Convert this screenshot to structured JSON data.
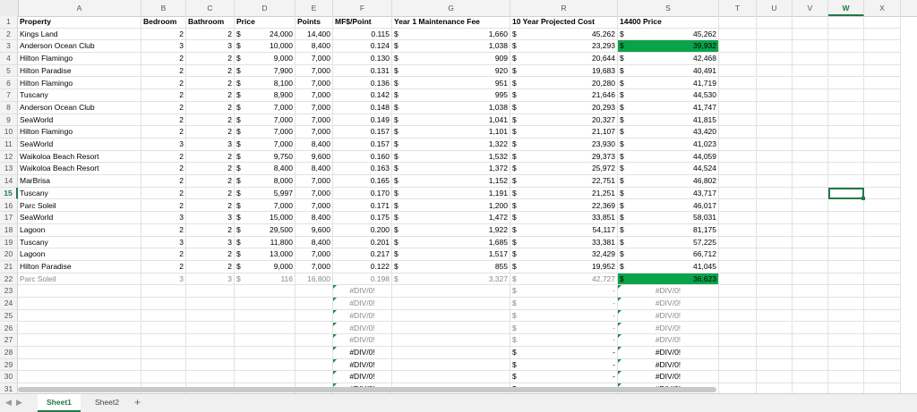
{
  "columns": [
    "A",
    "B",
    "C",
    "D",
    "E",
    "F",
    "G",
    "R",
    "S",
    "T",
    "U",
    "V",
    "W",
    "X"
  ],
  "selected_column": "W",
  "selected_row": "15",
  "header_row": {
    "property": "Property",
    "bedroom": "Bedroom",
    "bathroom": "Bathroom",
    "price": "Price",
    "points": "Points",
    "mf_point": "MF$/Point",
    "maint_fee": "Year 1 Maintenance Fee",
    "projected": "10 Year Projected Cost",
    "price14400": "14400 Price"
  },
  "rows": [
    {
      "n": "2",
      "property": "Kings Land",
      "bed": "2",
      "bath": "2",
      "price": "24,000",
      "points": "14,400",
      "mf": "0.115",
      "fee": "1,660",
      "proj": "45,262",
      "p14": "45,262"
    },
    {
      "n": "3",
      "property": "Anderson Ocean Club",
      "bed": "3",
      "bath": "3",
      "price": "10,000",
      "points": "8,400",
      "mf": "0.124",
      "fee": "1,038",
      "proj": "23,293",
      "p14": "39,932",
      "hl": true
    },
    {
      "n": "4",
      "property": "Hilton Flamingo",
      "bed": "2",
      "bath": "2",
      "price": "9,000",
      "points": "7,000",
      "mf": "0.130",
      "fee": "909",
      "proj": "20,644",
      "p14": "42,468"
    },
    {
      "n": "5",
      "property": "Hilton Paradise",
      "bed": "2",
      "bath": "2",
      "price": "7,900",
      "points": "7,000",
      "mf": "0.131",
      "fee": "920",
      "proj": "19,683",
      "p14": "40,491"
    },
    {
      "n": "6",
      "property": "Hilton Flamingo",
      "bed": "2",
      "bath": "2",
      "price": "8,100",
      "points": "7,000",
      "mf": "0.136",
      "fee": "951",
      "proj": "20,280",
      "p14": "41,719"
    },
    {
      "n": "7",
      "property": "Tuscany",
      "bed": "2",
      "bath": "2",
      "price": "8,900",
      "points": "7,000",
      "mf": "0.142",
      "fee": "995",
      "proj": "21,646",
      "p14": "44,530"
    },
    {
      "n": "8",
      "property": "Anderson Ocean Club",
      "bed": "2",
      "bath": "2",
      "price": "7,000",
      "points": "7,000",
      "mf": "0.148",
      "fee": "1,038",
      "proj": "20,293",
      "p14": "41,747"
    },
    {
      "n": "9",
      "property": "SeaWorld",
      "bed": "2",
      "bath": "2",
      "price": "7,000",
      "points": "7,000",
      "mf": "0.149",
      "fee": "1,041",
      "proj": "20,327",
      "p14": "41,815"
    },
    {
      "n": "10",
      "property": "Hilton Flamingo",
      "bed": "2",
      "bath": "2",
      "price": "7,000",
      "points": "7,000",
      "mf": "0.157",
      "fee": "1,101",
      "proj": "21,107",
      "p14": "43,420"
    },
    {
      "n": "11",
      "property": "SeaWorld",
      "bed": "3",
      "bath": "3",
      "price": "7,000",
      "points": "8,400",
      "mf": "0.157",
      "fee": "1,322",
      "proj": "23,930",
      "p14": "41,023"
    },
    {
      "n": "12",
      "property": "Waikoloa Beach Resort",
      "bed": "2",
      "bath": "2",
      "price": "9,750",
      "points": "9,600",
      "mf": "0.160",
      "fee": "1,532",
      "proj": "29,373",
      "p14": "44,059"
    },
    {
      "n": "13",
      "property": "Waikoloa Beach Resort",
      "bed": "2",
      "bath": "2",
      "price": "8,400",
      "points": "8,400",
      "mf": "0.163",
      "fee": "1,372",
      "proj": "25,972",
      "p14": "44,524"
    },
    {
      "n": "14",
      "property": "MarBrisa",
      "bed": "2",
      "bath": "2",
      "price": "8,000",
      "points": "7,000",
      "mf": "0.165",
      "fee": "1,152",
      "proj": "22,751",
      "p14": "46,802"
    },
    {
      "n": "15",
      "property": "Tuscany",
      "bed": "2",
      "bath": "2",
      "price": "5,997",
      "points": "7,000",
      "mf": "0.170",
      "fee": "1,191",
      "proj": "21,251",
      "p14": "43,717"
    },
    {
      "n": "16",
      "property": "Parc Soleil",
      "bed": "2",
      "bath": "2",
      "price": "7,000",
      "points": "7,000",
      "mf": "0.171",
      "fee": "1,200",
      "proj": "22,369",
      "p14": "46,017"
    },
    {
      "n": "17",
      "property": "SeaWorld",
      "bed": "3",
      "bath": "3",
      "price": "15,000",
      "points": "8,400",
      "mf": "0.175",
      "fee": "1,472",
      "proj": "33,851",
      "p14": "58,031"
    },
    {
      "n": "18",
      "property": "Lagoon",
      "bed": "2",
      "bath": "2",
      "price": "29,500",
      "points": "9,600",
      "mf": "0.200",
      "fee": "1,922",
      "proj": "54,117",
      "p14": "81,175"
    },
    {
      "n": "19",
      "property": "Tuscany",
      "bed": "3",
      "bath": "3",
      "price": "11,800",
      "points": "8,400",
      "mf": "0.201",
      "fee": "1,685",
      "proj": "33,381",
      "p14": "57,225"
    },
    {
      "n": "20",
      "property": "Lagoon",
      "bed": "2",
      "bath": "2",
      "price": "13,000",
      "points": "7,000",
      "mf": "0.217",
      "fee": "1,517",
      "proj": "32,429",
      "p14": "66,712"
    },
    {
      "n": "21",
      "property": "Hilton Paradise",
      "bed": "2",
      "bath": "2",
      "price": "9,000",
      "points": "7,000",
      "mf": "0.122",
      "fee": "855",
      "proj": "19,952",
      "p14": "41,045"
    },
    {
      "n": "22",
      "property": "Parc Soleil",
      "bed": "3",
      "bath": "3",
      "price": "116",
      "points": "16,800",
      "mf": "0.198",
      "fee": "3,327",
      "proj": "42,727",
      "p14": "36,623",
      "hl": true,
      "dim": true
    }
  ],
  "empty_rows": [
    "23",
    "24",
    "25",
    "26",
    "27",
    "28",
    "29",
    "30",
    "31"
  ],
  "dollar": "$",
  "dash": "-",
  "div0": "#DIV/0!",
  "sheet_tabs": [
    "Sheet1",
    "Sheet2"
  ],
  "active_tab": "Sheet1",
  "add_sheet": "+",
  "colors": {
    "accent": "#1e7b45",
    "highlight": "#0ba34a"
  }
}
